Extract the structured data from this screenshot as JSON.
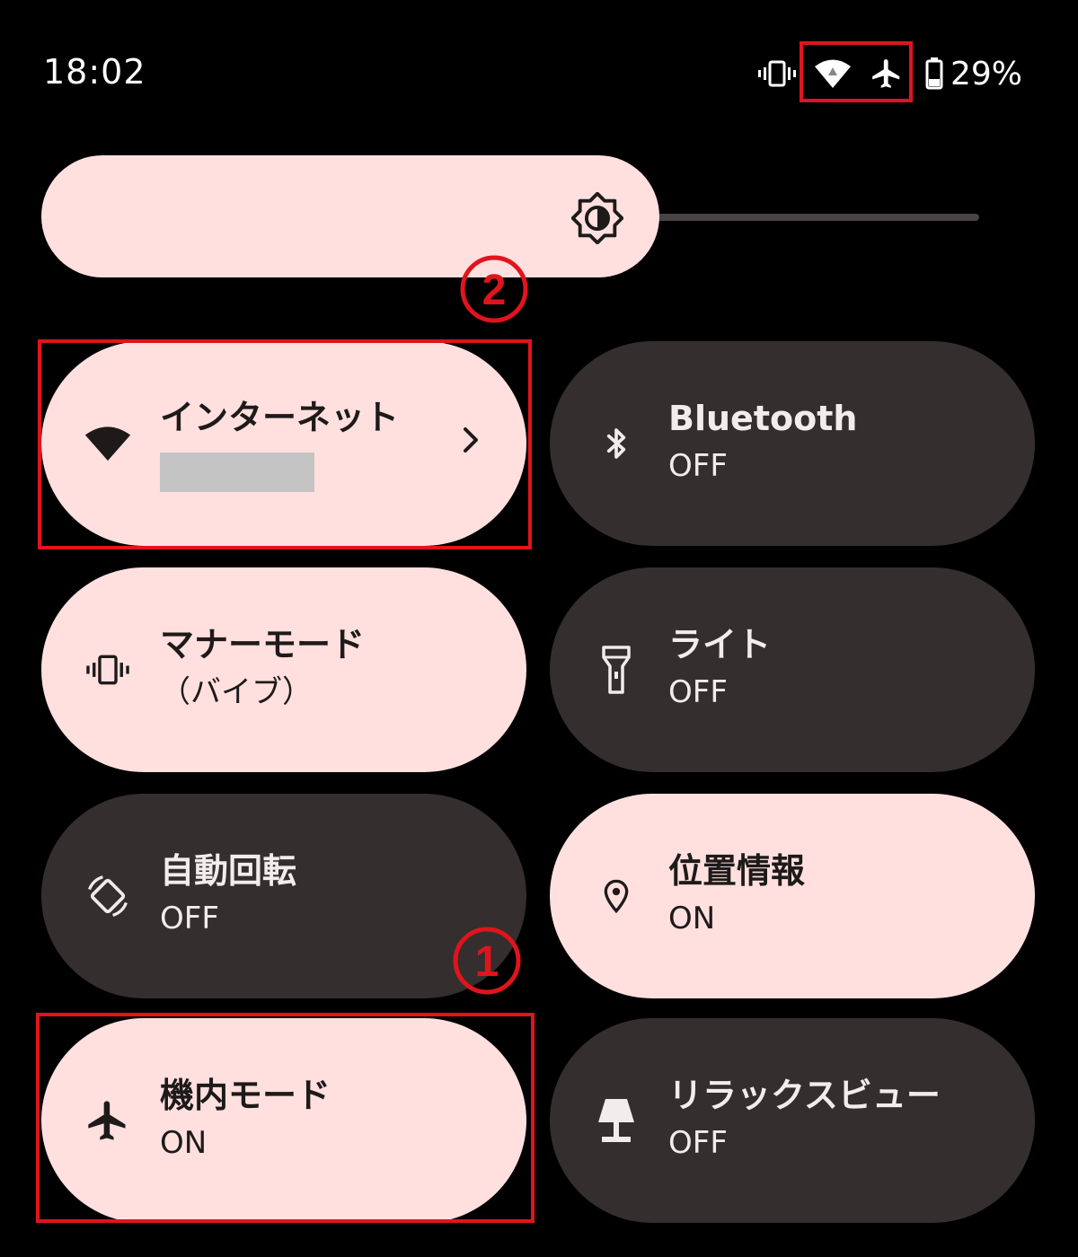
{
  "status_bar": {
    "time": "18:02",
    "battery_percent": "29%",
    "icons": [
      "vibrate-icon",
      "wifi-icon",
      "airplane-icon",
      "battery-icon"
    ]
  },
  "brightness": {
    "icon": "brightness-icon"
  },
  "tiles": [
    {
      "title": "インターネット",
      "subtitle": "",
      "state": "on",
      "icon": "wifi-icon",
      "has_chevron": true
    },
    {
      "title": "Bluetooth",
      "subtitle": "OFF",
      "state": "off",
      "icon": "bluetooth-icon"
    },
    {
      "title": "マナーモード",
      "subtitle": "（バイブ）",
      "state": "on",
      "icon": "vibrate-icon"
    },
    {
      "title": "ライト",
      "subtitle": "OFF",
      "state": "off",
      "icon": "flashlight-icon"
    },
    {
      "title": "自動回転",
      "subtitle": "OFF",
      "state": "off",
      "icon": "auto-rotate-icon"
    },
    {
      "title": "位置情報",
      "subtitle": "ON",
      "state": "on",
      "icon": "location-icon"
    },
    {
      "title": "機内モード",
      "subtitle": "ON",
      "state": "on",
      "icon": "airplane-icon"
    },
    {
      "title": "リラックスビュー",
      "subtitle": "OFF",
      "state": "off",
      "icon": "lamp-icon"
    }
  ],
  "annotations": {
    "marker_1": "①",
    "marker_2": "②"
  },
  "colors": {
    "tile_on": "#ffe0df",
    "tile_off": "#342e2e",
    "highlight": "#e0141c",
    "background": "#000000"
  }
}
